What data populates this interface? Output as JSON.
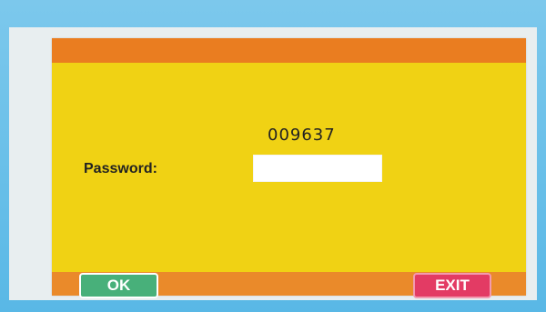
{
  "dialog": {
    "code": "009637",
    "password_label": "Password:",
    "password_value": "",
    "buttons": {
      "ok_label": "OK",
      "exit_label": "EXIT"
    }
  },
  "colors": {
    "panel": "#f0d214",
    "title_bar": "#ea7d20",
    "bottom_bar": "#ea8a2a",
    "ok_button": "#48b07a",
    "exit_button": "#e33b64",
    "screen_border": "#6fc3ea"
  }
}
